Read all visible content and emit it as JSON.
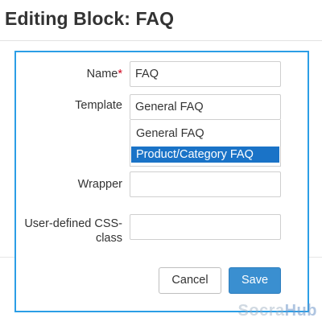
{
  "page": {
    "title": "Editing Block: FAQ"
  },
  "form": {
    "name": {
      "label": "Name",
      "required_mark": "*",
      "value": "FAQ"
    },
    "template": {
      "label": "Template",
      "selected": "General FAQ",
      "options": [
        "General FAQ",
        "Product/Category FAQ"
      ],
      "highlighted_option": "Product/Category FAQ"
    },
    "wrapper": {
      "label": "Wrapper",
      "value": ""
    },
    "css_class": {
      "label_line1": "User-defined CSS-",
      "label_line2": "class",
      "value": ""
    }
  },
  "buttons": {
    "cancel": "Cancel",
    "save": "Save"
  },
  "watermark": {
    "part1": "Socra",
    "part2": "Hub"
  },
  "colors": {
    "dialog_border": "#2c9ee6",
    "save_button": "#3a8fd0",
    "highlight": "#1a73c7"
  }
}
